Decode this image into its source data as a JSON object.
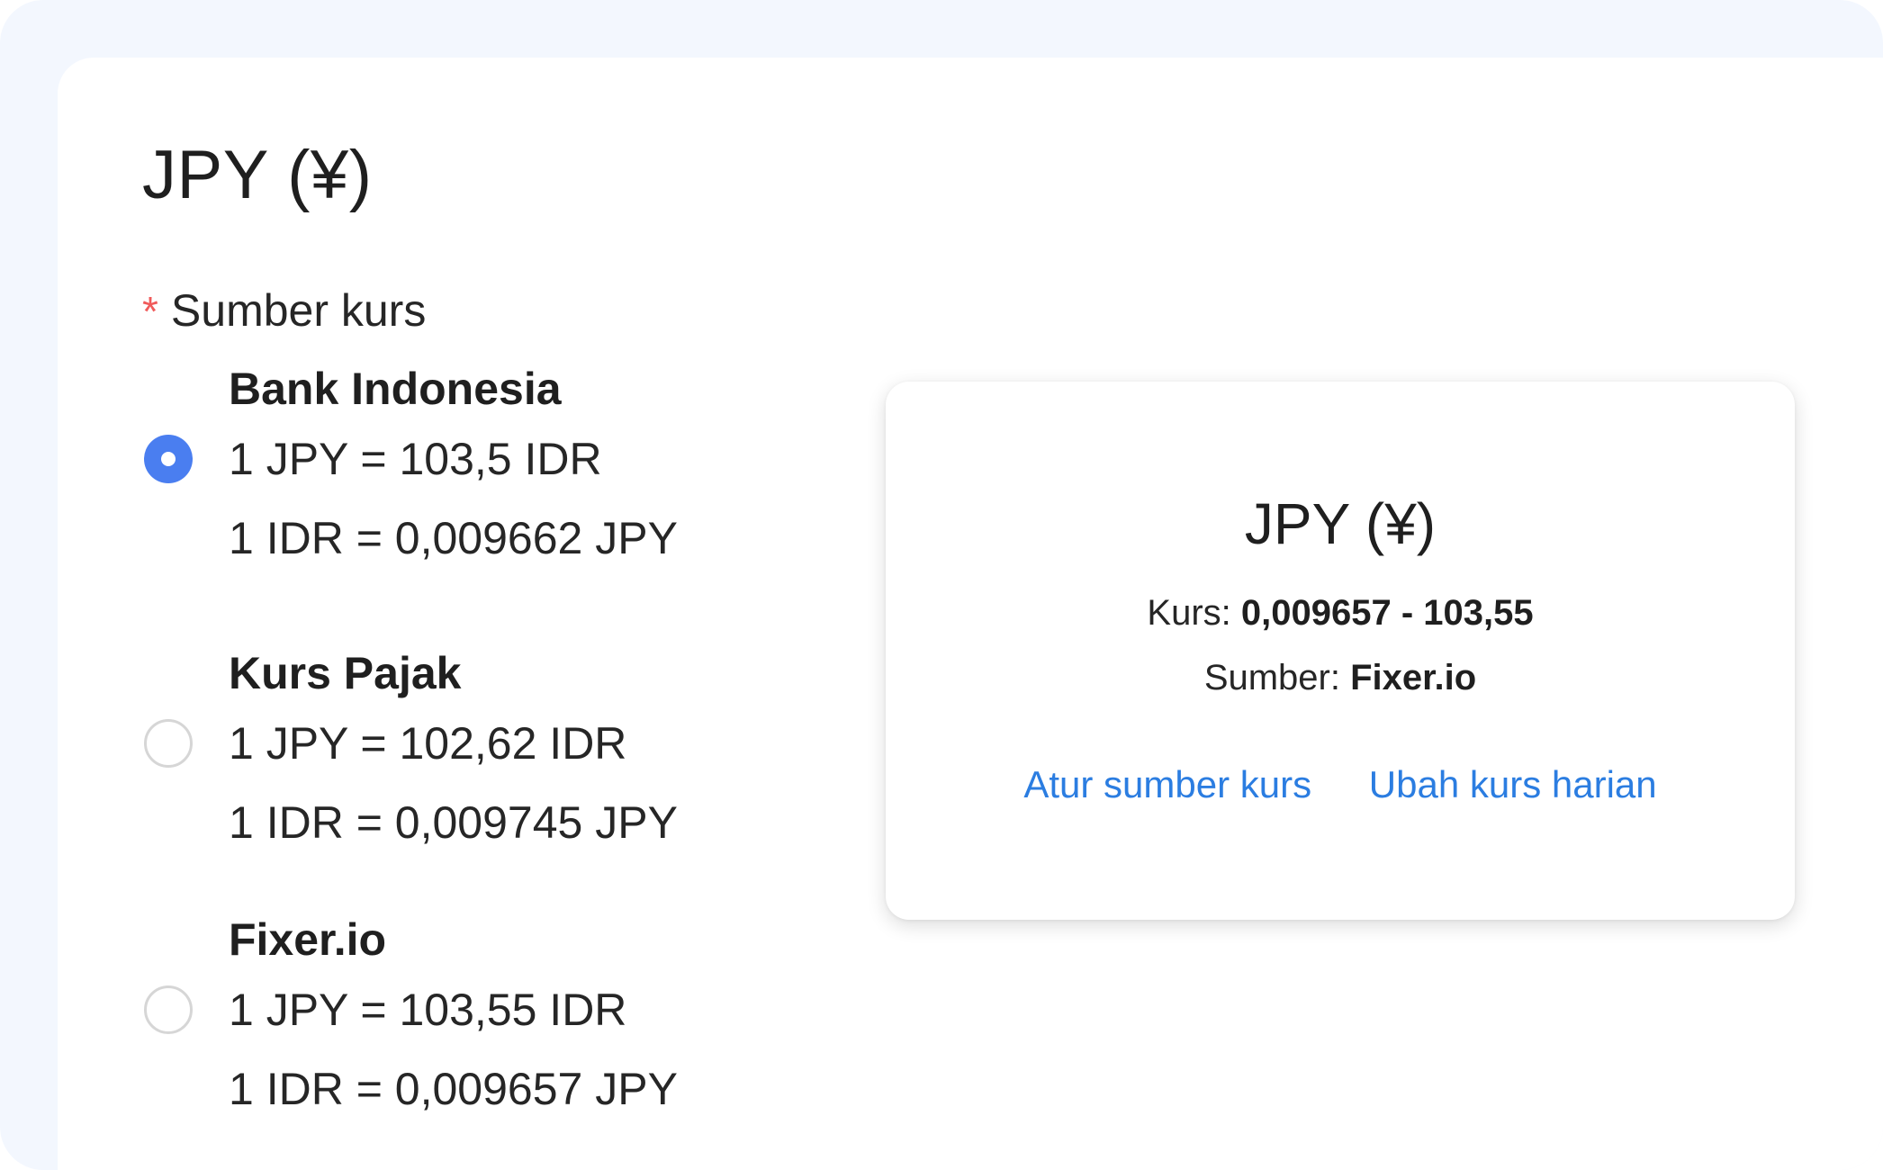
{
  "page": {
    "title": "JPY (¥)"
  },
  "field": {
    "required_mark": "*",
    "label": "Sumber kurs"
  },
  "options": [
    {
      "name": "Bank Indonesia",
      "rate_line_1": "1 JPY = 103,5 IDR",
      "rate_line_2": "1 IDR = 0,009662 JPY",
      "selected": true
    },
    {
      "name": "Kurs Pajak",
      "rate_line_1": "1 JPY = 102,62 IDR",
      "rate_line_2": "1 IDR = 0,009745 JPY",
      "selected": false
    },
    {
      "name": "Fixer.io",
      "rate_line_1": "1 JPY = 103,55 IDR",
      "rate_line_2": "1 IDR = 0,009657 JPY",
      "selected": false
    }
  ],
  "card": {
    "title": "JPY (¥)",
    "kurs_label": "Kurs:",
    "kurs_value": "0,009657 - 103,55",
    "source_label": "Sumber:",
    "source_value": "Fixer.io",
    "link_set_source": "Atur sumber kurs",
    "link_change_daily": "Ubah kurs harian"
  },
  "colors": {
    "background": "#f3f7fe",
    "accent_radio": "#4a7ef0",
    "link": "#2b7de1",
    "required": "#f05a5a"
  }
}
